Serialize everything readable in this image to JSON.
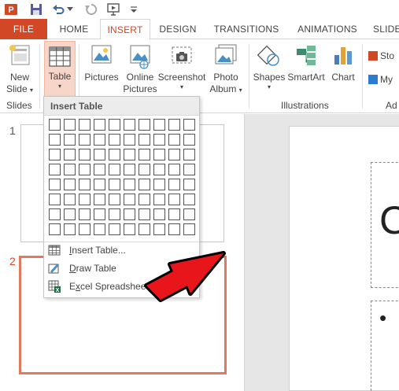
{
  "quick_access": {
    "icons": [
      "powerpoint-logo",
      "save-icon",
      "undo-icon",
      "undo-dropdown",
      "redo-icon",
      "start-from-beginning-icon",
      "customize-qat-icon"
    ]
  },
  "tabs": [
    {
      "label": "FILE"
    },
    {
      "label": "HOME"
    },
    {
      "label": "INSERT",
      "active": true
    },
    {
      "label": "DESIGN"
    },
    {
      "label": "TRANSITIONS"
    },
    {
      "label": "ANIMATIONS"
    },
    {
      "label": "SLIDE"
    }
  ],
  "ribbon": {
    "new_slide": {
      "line1": "New",
      "line2": "Slide",
      "arrow": "▾"
    },
    "table": {
      "label": "Table",
      "arrow": "▾"
    },
    "pictures": {
      "label": "Pictures"
    },
    "online_pictures": {
      "line1": "Online",
      "line2": "Pictures"
    },
    "screenshot": {
      "label": "Screenshot",
      "arrow": "▾"
    },
    "photo_album": {
      "line1": "Photo",
      "line2": "Album",
      "arrow": "▾"
    },
    "shapes": {
      "label": "Shapes",
      "arrow": "▾"
    },
    "smartart": {
      "label": "SmartArt"
    },
    "chart": {
      "label": "Chart"
    },
    "store": {
      "label": "Sto"
    },
    "my_apps": {
      "label": "My"
    },
    "groups": {
      "slides": "Slides",
      "illustrations": "Illustrations",
      "addins": "Ad"
    }
  },
  "thumbnails": [
    {
      "number": "1"
    },
    {
      "number": "2",
      "selected": true
    }
  ],
  "slide": {
    "title_char": "C",
    "bullet": "•"
  },
  "insert_table_menu": {
    "heading": "Insert Table",
    "grid_columns": 10,
    "grid_rows": 8,
    "items": [
      {
        "label": "Insert Table...",
        "underline_index": 0,
        "icon": "insert-table-icon"
      },
      {
        "label": "Draw Table",
        "underline_index": 0,
        "icon": "draw-table-icon"
      },
      {
        "label": "Excel Spreadsheet",
        "underline_index": 1,
        "icon": "excel-icon"
      }
    ]
  },
  "annotation": {
    "arrow_color": "#e8151b",
    "arrow_points_to": "Excel Spreadsheet"
  },
  "colors": {
    "accent": "#d24726",
    "thumb_selected": "#e07a5f"
  }
}
